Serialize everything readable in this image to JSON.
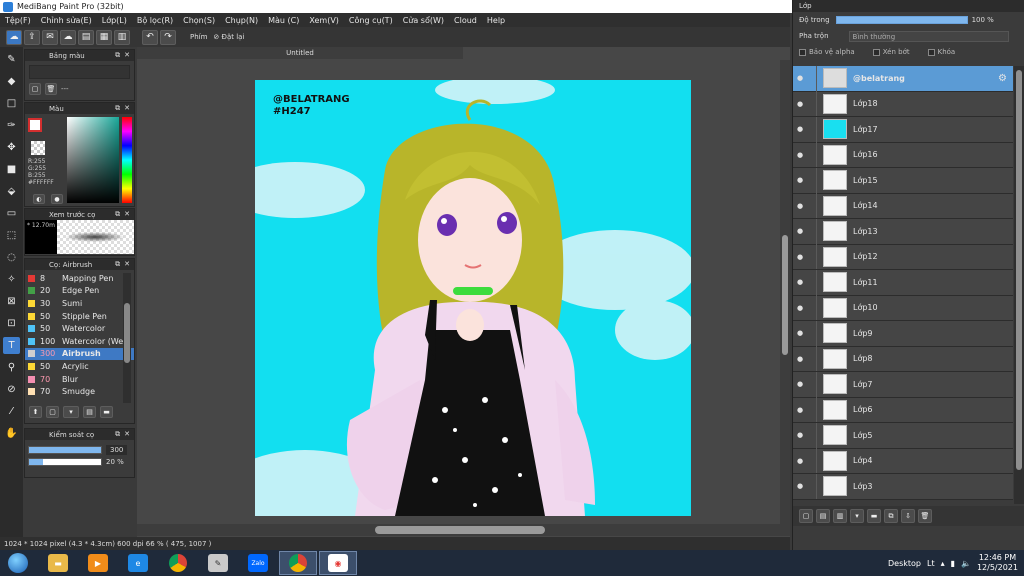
{
  "window": {
    "title": "MediBang Paint Pro (32bit)"
  },
  "menu": [
    "Tệp(F)",
    "Chỉnh sửa(E)",
    "Lớp(L)",
    "Bộ lọc(R)",
    "Chọn(S)",
    "Chụp(N)",
    "Màu (C)",
    "Xem(V)",
    "Công cụ(T)",
    "Cửa sổ(W)",
    "Cloud",
    "Help"
  ],
  "toolbar": {
    "phim_label": "Phím",
    "reset_label": "Đặt lại"
  },
  "panels": {
    "palette": {
      "title": "Bảng màu",
      "placeholder": "---"
    },
    "color": {
      "title": "Màu",
      "r": "R:255",
      "g": "G:255",
      "b": "B:255",
      "hex": "#FFFFFF"
    },
    "preview": {
      "title": "Xem trước cọ",
      "size": "12.70m"
    },
    "brush": {
      "title": "Cọ: Airbrush",
      "items": [
        {
          "size": "8",
          "name": "Mapping Pen",
          "color": "#e53935"
        },
        {
          "size": "20",
          "name": "Edge Pen",
          "color": "#43a047"
        },
        {
          "size": "30",
          "name": "Sumi",
          "color": "#fdd835"
        },
        {
          "size": "50",
          "name": "Stipple Pen",
          "color": "#fdd835"
        },
        {
          "size": "50",
          "name": "Watercolor",
          "color": "#4fc3f7"
        },
        {
          "size": "100",
          "name": "Watercolor (Wet)",
          "color": "#4fc3f7"
        },
        {
          "size": "300",
          "name": "Airbrush",
          "color": "#cfcfcf"
        },
        {
          "size": "50",
          "name": "Acrylic",
          "color": "#fdd835"
        },
        {
          "size": "70",
          "name": "Blur",
          "color": "#f48fb1"
        },
        {
          "size": "70",
          "name": "Smudge",
          "color": "#ffe0b2"
        }
      ]
    },
    "brush_control": {
      "title": "Kiểm soát cọ",
      "size_value": "300",
      "opacity_value": "20 %",
      "size_fill": 1.0,
      "opacity_fill": 0.2
    }
  },
  "document": {
    "tab_title": "Untitled",
    "watermark_line1": "@BELATRANG",
    "watermark_line2": "#H247"
  },
  "status": {
    "text": "1024 * 1024 pixel  (4.3 * 4.3cm)  600 dpi  66 %  ( 475, 1007 )"
  },
  "layers_panel": {
    "title": "Lớp",
    "opacity_label": "Độ trong",
    "opacity_value": "100 %",
    "opacity_fill": 1.0,
    "blend_label": "Pha trộn",
    "blend_value": "Bình thường",
    "protect_alpha": "Bảo vệ alpha",
    "clipping": "Xén bớt",
    "lock": "Khóa",
    "layers": [
      {
        "name": "@belatrang",
        "selected": true
      },
      {
        "name": "Lớp18"
      },
      {
        "name": "Lớp17",
        "cyan": true
      },
      {
        "name": "Lớp16"
      },
      {
        "name": "Lớp15"
      },
      {
        "name": "Lớp14"
      },
      {
        "name": "Lớp13"
      },
      {
        "name": "Lớp12"
      },
      {
        "name": "Lớp11"
      },
      {
        "name": "Lớp10"
      },
      {
        "name": "Lớp9"
      },
      {
        "name": "Lớp8"
      },
      {
        "name": "Lớp7"
      },
      {
        "name": "Lớp6"
      },
      {
        "name": "Lớp5"
      },
      {
        "name": "Lớp4"
      },
      {
        "name": "Lớp3"
      }
    ]
  },
  "taskbar": {
    "zalo_label": "Zalo",
    "desktop_label": "Desktop",
    "lang": "Lt",
    "time": "12:46 PM",
    "date": "12/5/2021"
  }
}
